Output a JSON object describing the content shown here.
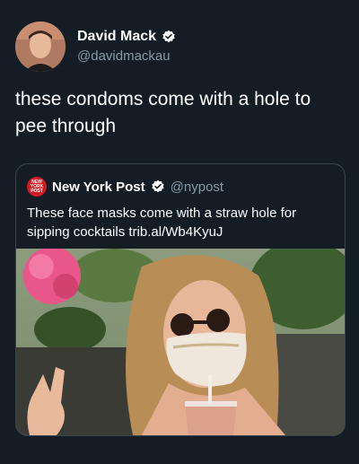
{
  "tweet": {
    "author_name": "David Mack",
    "author_handle": "@davidmackau",
    "text": "these condoms come with a hole to pee through"
  },
  "quoted_tweet": {
    "author_name": "New York Post",
    "author_handle": "@nypost",
    "logo_text": "NEW YORK POST",
    "text": "These face masks come with a straw hole for sipping cocktails trib.al/Wb4KyuJ"
  },
  "colors": {
    "background": "#141d26",
    "verified_badge": "#ffffff",
    "secondary_text": "#8899a6",
    "nypost_red": "#d21c25"
  },
  "icons": [
    "verified-badge-icon",
    "avatar-photo",
    "nypost-logo",
    "quoted-photo"
  ]
}
